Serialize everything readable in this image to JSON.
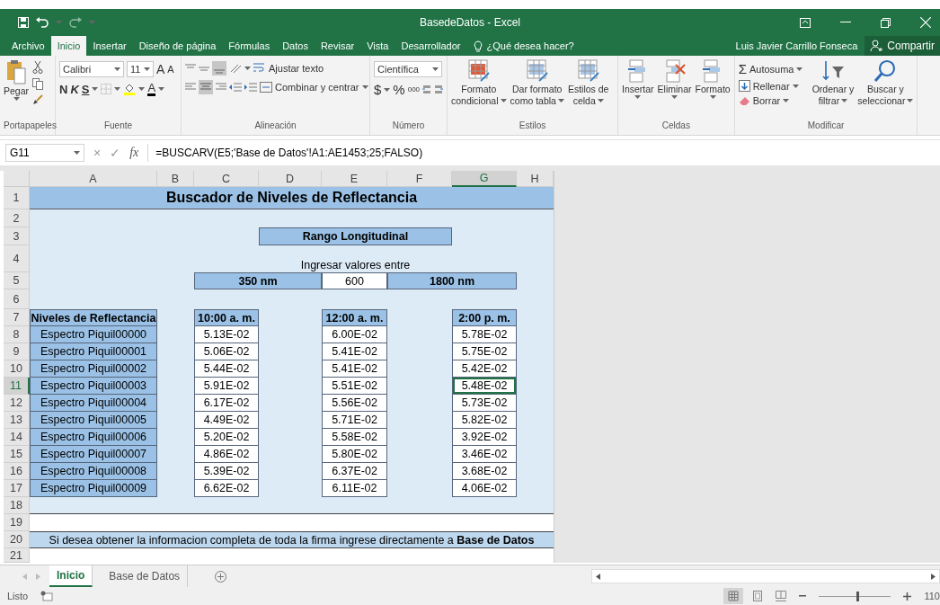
{
  "window": {
    "title": "BasedeDatos - Excel"
  },
  "menu_tabs": [
    {
      "label": "Archivo",
      "selected": false
    },
    {
      "label": "Inicio",
      "selected": true
    },
    {
      "label": "Insertar",
      "selected": false
    },
    {
      "label": "Diseño de página",
      "selected": false
    },
    {
      "label": "Fórmulas",
      "selected": false
    },
    {
      "label": "Datos",
      "selected": false
    },
    {
      "label": "Revisar",
      "selected": false
    },
    {
      "label": "Vista",
      "selected": false
    },
    {
      "label": "Desarrollador",
      "selected": false
    }
  ],
  "tell_me": "¿Qué desea hacer?",
  "user": "Luis Javier Carrillo Fonseca",
  "share": "Compartir",
  "clipboard": {
    "paste": "Pegar",
    "group": "Portapapeles"
  },
  "font": {
    "name": "Calibri",
    "size": "11",
    "grow": "A",
    "shrink": "A",
    "bold": "N",
    "italic": "K",
    "underline": "S",
    "color_letter": "A",
    "group": "Fuente"
  },
  "alignment": {
    "wrap": "Ajustar texto",
    "merge": "Combinar y centrar",
    "group": "Alineación"
  },
  "number": {
    "format": "Científica",
    "currency": "$",
    "percent": "%",
    "thousands": "000",
    "group": "Número"
  },
  "styles": {
    "buttons": [
      [
        "Formato",
        "condicional"
      ],
      [
        "Dar formato",
        "como tabla"
      ],
      [
        "Estilos de",
        "celda"
      ]
    ],
    "group": "Estilos"
  },
  "cells": {
    "buttons": [
      "Insertar",
      "Eliminar",
      "Formato"
    ],
    "group": "Celdas"
  },
  "editing": {
    "sigma": "Σ",
    "autosum": "Autosuma",
    "fill": "Rellenar",
    "clear": "Borrar",
    "sort": [
      "Ordenar y",
      "filtrar"
    ],
    "find": [
      "Buscar y",
      "seleccionar"
    ],
    "group": "Modificar"
  },
  "formula_bar": {
    "name_box": "G11",
    "cancel": "×",
    "enter": "✓",
    "fx": "fx",
    "formula": "=BUSCARV(E5;'Base de Datos'!A1:AE1453;25;FALSO)"
  },
  "sheet": {
    "columns": [
      {
        "label": "A",
        "selected": false
      },
      {
        "label": "B",
        "selected": false
      },
      {
        "label": "C",
        "selected": false
      },
      {
        "label": "D",
        "selected": false
      },
      {
        "label": "E",
        "selected": false
      },
      {
        "label": "F",
        "selected": false
      },
      {
        "label": "G",
        "selected": true
      },
      {
        "label": "H",
        "selected": false
      }
    ],
    "rows": [
      {
        "label": "1",
        "selected": false
      },
      {
        "label": "2",
        "selected": false
      },
      {
        "label": "3",
        "selected": false
      },
      {
        "label": "4",
        "selected": false
      },
      {
        "label": "5",
        "selected": false
      },
      {
        "label": "6",
        "selected": false
      },
      {
        "label": "7",
        "selected": false
      },
      {
        "label": "8",
        "selected": false
      },
      {
        "label": "9",
        "selected": false
      },
      {
        "label": "10",
        "selected": false
      },
      {
        "label": "11",
        "selected": true
      },
      {
        "label": "12",
        "selected": false
      },
      {
        "label": "13",
        "selected": false
      },
      {
        "label": "14",
        "selected": false
      },
      {
        "label": "15",
        "selected": false
      },
      {
        "label": "16",
        "selected": false
      },
      {
        "label": "17",
        "selected": false
      },
      {
        "label": "18",
        "selected": false
      },
      {
        "label": "19",
        "selected": false
      },
      {
        "label": "20",
        "selected": false
      },
      {
        "label": "21",
        "selected": false
      }
    ],
    "title": "Buscador de Niveles de Reflectancia",
    "range_title": "Rango Longitudinal",
    "range_hint": "Ingresar valores entre",
    "range_from": "350 nm",
    "range_input": "600",
    "range_to": "1800 nm",
    "table": {
      "columns": [
        "Niveles de Reflectancia",
        "10:00 a. m.",
        "12:00 a. m.",
        "2:00 p. m."
      ],
      "rows": [
        [
          "Espectro Piquil00000",
          "5.13E-02",
          "6.00E-02",
          "5.78E-02"
        ],
        [
          "Espectro Piquil00001",
          "5.06E-02",
          "5.41E-02",
          "5.75E-02"
        ],
        [
          "Espectro Piquil00002",
          "5.44E-02",
          "5.41E-02",
          "5.42E-02"
        ],
        [
          "Espectro Piquil00003",
          "5.91E-02",
          "5.51E-02",
          "5.48E-02"
        ],
        [
          "Espectro Piquil00004",
          "6.17E-02",
          "5.56E-02",
          "5.73E-02"
        ],
        [
          "Espectro Piquil00005",
          "4.49E-02",
          "5.71E-02",
          "5.82E-02"
        ],
        [
          "Espectro Piquil00006",
          "5.20E-02",
          "5.58E-02",
          "3.92E-02"
        ],
        [
          "Espectro Piquil00007",
          "4.86E-02",
          "5.80E-02",
          "3.46E-02"
        ],
        [
          "Espectro Piquil00008",
          "5.39E-02",
          "6.37E-02",
          "3.68E-02"
        ],
        [
          "Espectro Piquil00009",
          "6.62E-02",
          "6.11E-02",
          "4.06E-02"
        ]
      ]
    },
    "note": "Si desea obtener la informacion completa de toda la firma ingrese directamente a **Base de Datos**"
  },
  "sheet_tabs": [
    {
      "label": "Inicio",
      "selected": true
    },
    {
      "label": "Base de Datos",
      "selected": false
    }
  ],
  "status_bar": {
    "text": "Listo",
    "zoom": {
      "level": 0.53,
      "reading": "110"
    }
  }
}
